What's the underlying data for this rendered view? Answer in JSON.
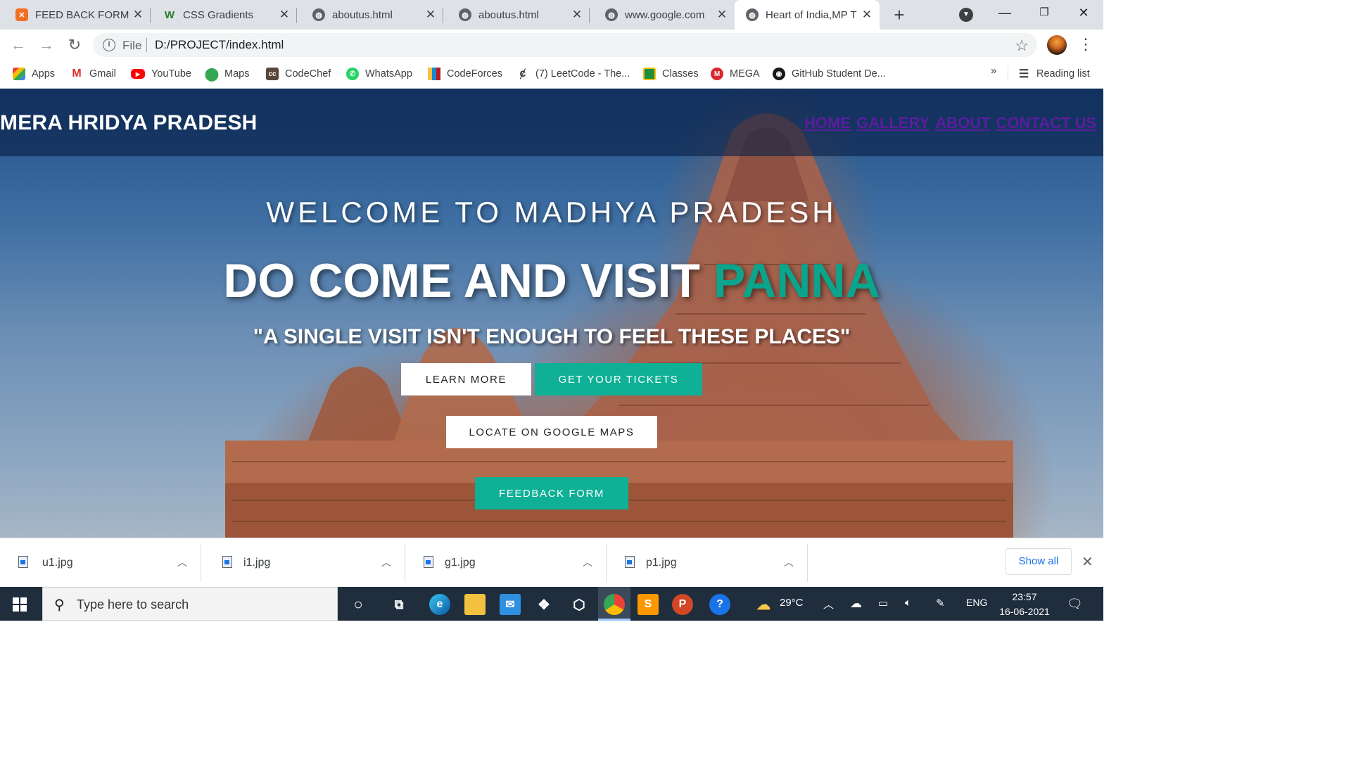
{
  "browser": {
    "tabs": [
      {
        "title": "FEED BACK FORM",
        "active": false
      },
      {
        "title": "CSS Gradients",
        "active": false
      },
      {
        "title": "aboutus.html",
        "active": false
      },
      {
        "title": "aboutus.html",
        "active": false
      },
      {
        "title": "www.google.com",
        "active": false
      },
      {
        "title": "Heart of India,MP T",
        "active": true
      }
    ],
    "address": {
      "scheme_label": "File",
      "url": "D:/PROJECT/index.html"
    },
    "bookmarks": [
      {
        "label": "Apps",
        "icon": "apps-grid-icon"
      },
      {
        "label": "Gmail",
        "icon": "gmail-icon"
      },
      {
        "label": "YouTube",
        "icon": "youtube-icon"
      },
      {
        "label": "Maps",
        "icon": "maps-pin-icon"
      },
      {
        "label": "CodeChef",
        "icon": "codechef-icon"
      },
      {
        "label": "WhatsApp",
        "icon": "whatsapp-icon"
      },
      {
        "label": "CodeForces",
        "icon": "codeforces-icon"
      },
      {
        "label": "(7) LeetCode - The...",
        "icon": "leetcode-icon"
      },
      {
        "label": "Classes",
        "icon": "classroom-icon"
      },
      {
        "label": "MEGA",
        "icon": "mega-icon"
      },
      {
        "label": "GitHub Student De...",
        "icon": "github-icon"
      }
    ],
    "more_bookmarks": "»",
    "reading_list": "Reading list"
  },
  "site": {
    "brand": "MERA HRIDYA PRADESH",
    "nav": [
      "HOME",
      "GALLERY",
      "ABOUT",
      "CONTACT US"
    ],
    "welcome": "WELCOME TO MADHYA PRADESH",
    "headline_prefix": "DO COME AND VISIT",
    "headline_accent": "PANNA",
    "quote": "\"A SINGLE VISIT ISN'T ENOUGH TO FEEL THESE PLACES\"",
    "buttons": {
      "learn_more": "LEARN MORE",
      "tickets": "GET YOUR TICKETS",
      "maps": "LOCATE ON GOOGLE MAPS",
      "feedback": "FEEDBACK FORM"
    },
    "colors": {
      "accent": "#0fb096",
      "nav_link": "#5a1d9c"
    }
  },
  "downloads": {
    "files": [
      "u1.jpg",
      "i1.jpg",
      "g1.jpg",
      "p1.jpg"
    ],
    "show_all": "Show all"
  },
  "taskbar": {
    "search_placeholder": "Type here to search",
    "weather": "29°C",
    "language": "ENG",
    "time": "23:57",
    "date": "16-06-2021"
  }
}
